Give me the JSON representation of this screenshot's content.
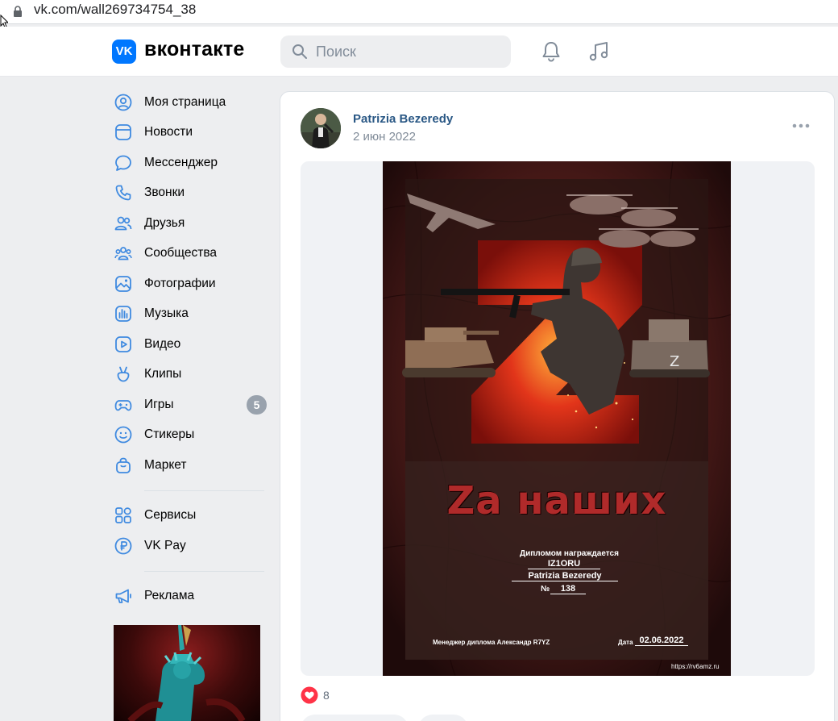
{
  "browser": {
    "url": "vk.com/wall269734754_38"
  },
  "header": {
    "logo_mark": "VK",
    "logo_text": "вконтакте",
    "search_placeholder": "Поиск"
  },
  "sidebar": {
    "items": [
      {
        "label": "Моя страница",
        "icon": "user-circle-icon"
      },
      {
        "label": "Новости",
        "icon": "news-icon"
      },
      {
        "label": "Мессенджер",
        "icon": "message-bubble-icon"
      },
      {
        "label": "Звонки",
        "icon": "phone-icon"
      },
      {
        "label": "Друзья",
        "icon": "friends-icon"
      },
      {
        "label": "Сообщества",
        "icon": "communities-icon"
      },
      {
        "label": "Фотографии",
        "icon": "photo-icon"
      },
      {
        "label": "Музыка",
        "icon": "music-bars-icon"
      },
      {
        "label": "Видео",
        "icon": "video-icon"
      },
      {
        "label": "Клипы",
        "icon": "clips-icon"
      },
      {
        "label": "Игры",
        "icon": "gamepad-icon",
        "badge": "5"
      },
      {
        "label": "Стикеры",
        "icon": "smile-icon"
      },
      {
        "label": "Маркет",
        "icon": "bag-icon"
      }
    ],
    "items2": [
      {
        "label": "Сервисы",
        "icon": "grid-icon"
      },
      {
        "label": "VK Pay",
        "icon": "ruble-icon"
      }
    ],
    "items3": [
      {
        "label": "Реклама",
        "icon": "megaphone-icon"
      }
    ]
  },
  "post": {
    "author": "Patrizia Bezeredy",
    "date": "2 июн 2022",
    "likes_count": "8",
    "image": {
      "title": "Za наших",
      "award_line": "Дипломом награждается",
      "callsign": "IZ1ORU",
      "name": "Patrizia Bezeredy",
      "number_label": "№",
      "number": "138",
      "manager": "Менеджер диплома  Александр R7YZ",
      "date_label": "Дата",
      "date": "02.06.2022",
      "site": "https://rv6amz.ru"
    }
  },
  "colors": {
    "accent": "#0077ff",
    "link": "#2a5885",
    "like": "#ff3347"
  }
}
